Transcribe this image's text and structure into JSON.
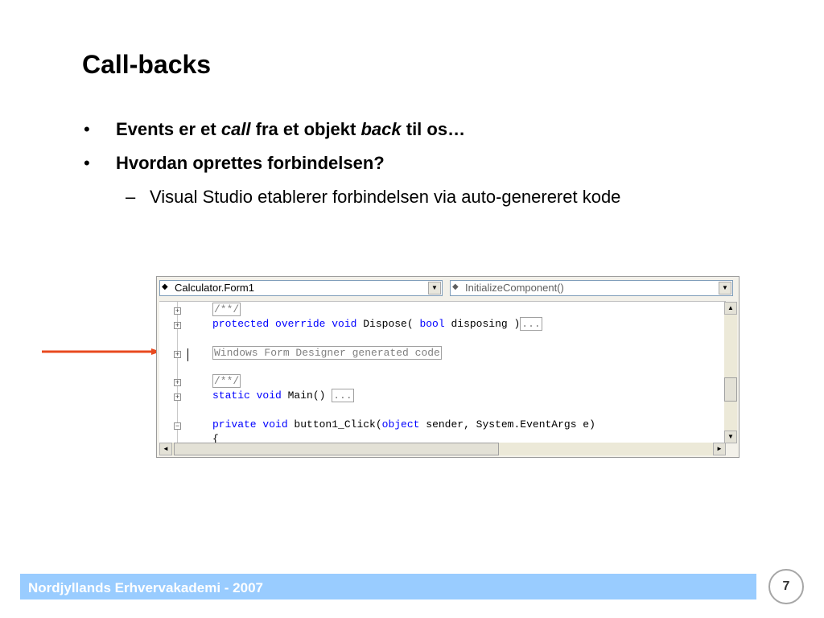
{
  "slide": {
    "title": "Call-backs",
    "bullet1": {
      "prefix": "Events er et ",
      "em1": "call",
      "mid": " fra et objekt ",
      "em2": "back",
      "suffix": " til os…"
    },
    "bullet2": "Hvordan oprettes forbindelsen?",
    "sub_bullet": "Visual Studio etablerer forbindelsen via auto-genereret kode",
    "bullet_symbol": "•",
    "dash_symbol": "–"
  },
  "editor": {
    "class_combo": "Calculator.Form1",
    "member_combo": "InitializeComponent()",
    "lines": [
      {
        "text": "/**/"
      },
      {
        "kw1": "protected override void",
        "rest": " Dispose( ",
        "kw2": "bool",
        "rest2": " disposing )",
        "box": "..."
      },
      {
        "text": "Windows Form Designer generated code"
      },
      {
        "text": "/**/"
      },
      {
        "kw1": "static void",
        "rest": " Main() ",
        "box": "..."
      },
      {
        "kw1": "private void",
        "rest": " button1_Click(",
        "kw2": "object",
        "rest2": " sender, System.EventArgs e)"
      },
      {
        "text": "{"
      }
    ]
  },
  "footer": {
    "text": "Nordjyllands Erhvervakademi - 2007",
    "page_number": "7"
  },
  "colors": {
    "footer_bar": "#99ccff",
    "arrow": "#e84a1f",
    "keyword": "#0000ff"
  }
}
